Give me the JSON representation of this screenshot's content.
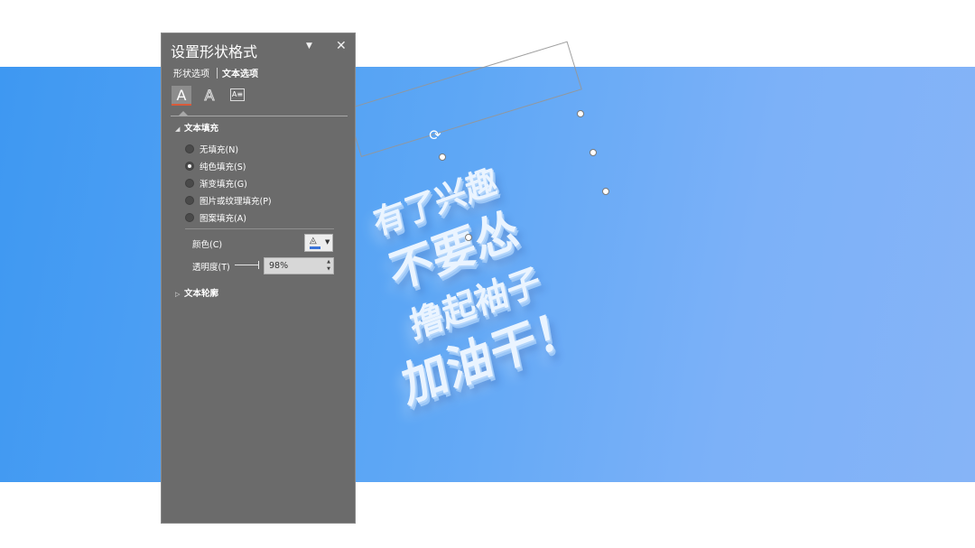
{
  "pane": {
    "title": "设置形状格式",
    "tabs": [
      "形状选项",
      "文本选项"
    ],
    "active_tab": "文本选项",
    "subicons": [
      "text-fill-outline-icon",
      "text-effects-icon",
      "textbox-icon"
    ],
    "text_fill": {
      "heading": "文本填充",
      "options": [
        "无填充(N)",
        "纯色填充(S)",
        "渐变填充(G)",
        "图片或纹理填充(P)",
        "图案填充(A)"
      ],
      "selected": "纯色填充(S)",
      "color_label": "颜色(C)",
      "color_value": "#3a73d8",
      "transparency_label": "透明度(T)",
      "transparency_value": "98%"
    },
    "text_outline": {
      "heading": "文本轮廓"
    }
  },
  "slide": {
    "art_lines": [
      "有了兴趣",
      "不要怂",
      "撸起袖子",
      "加油干！"
    ],
    "gradient_start": "#3e98f2",
    "gradient_end": "#86b4f7"
  }
}
